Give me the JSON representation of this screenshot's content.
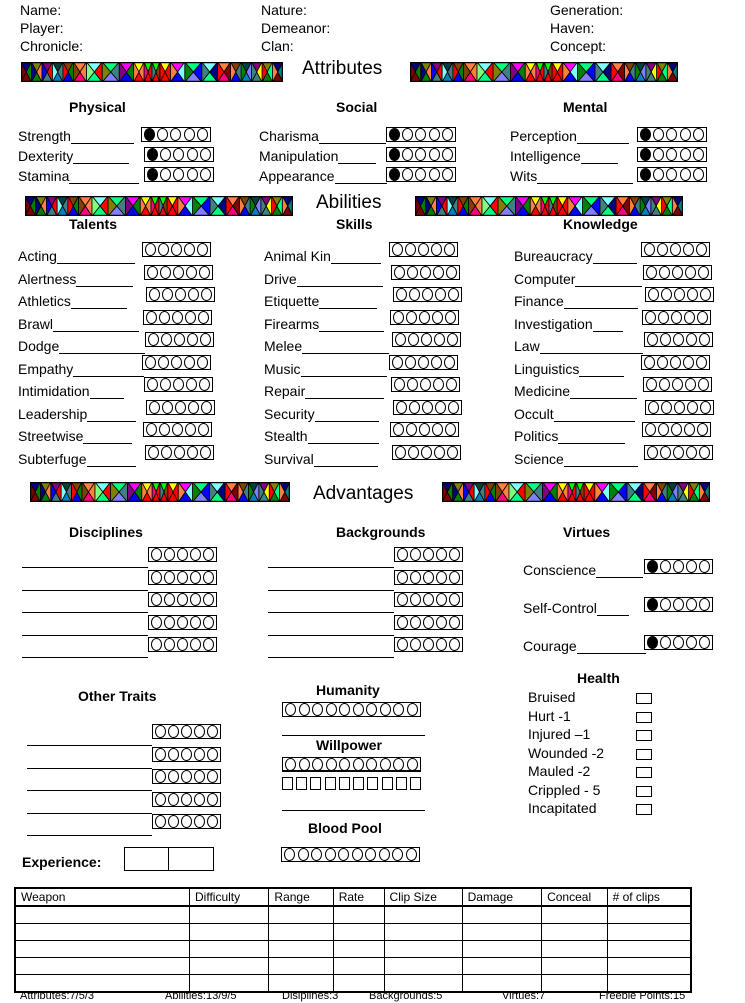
{
  "header": {
    "col1": [
      "Name:",
      "Player:",
      "Chronicle:"
    ],
    "col2": [
      "Nature:",
      "Demeanor:",
      "Clan:"
    ],
    "col3": [
      "Generation:",
      "Haven:",
      "Concept:"
    ]
  },
  "sections": {
    "attributes": "Attributes",
    "abilities": "Abilities",
    "advantages": "Advantages"
  },
  "attributes": {
    "physical": {
      "title": "Physical",
      "items": [
        {
          "label": "Strength",
          "value": 1
        },
        {
          "label": "Dexterity",
          "value": 1
        },
        {
          "label": "Stamina",
          "value": 1
        }
      ]
    },
    "social": {
      "title": "Social",
      "items": [
        {
          "label": "Charisma",
          "value": 1
        },
        {
          "label": "Manipulation",
          "value": 1
        },
        {
          "label": "Appearance",
          "value": 1
        }
      ]
    },
    "mental": {
      "title": "Mental",
      "items": [
        {
          "label": "Perception",
          "value": 1
        },
        {
          "label": "Intelligence",
          "value": 1
        },
        {
          "label": "Wits",
          "value": 1
        }
      ]
    }
  },
  "abilities": {
    "talents": {
      "title": "Talents",
      "items": [
        "Acting",
        "Alertness",
        "Athletics",
        "Brawl",
        "Dodge",
        "Empathy",
        "Intimidation",
        "Leadership",
        "Streetwise",
        "Subterfuge"
      ]
    },
    "skills": {
      "title": "Skills",
      "items": [
        "Animal Kin",
        "Drive",
        "Etiquette",
        "Firearms",
        "Melee",
        "Music",
        "Repair",
        "Security",
        "Stealth",
        "Survival"
      ]
    },
    "knowledge": {
      "title": "Knowledge",
      "items": [
        "Bureaucracy",
        "Computer",
        "Finance",
        "Investigation",
        "Law",
        "Linguistics",
        "Medicine",
        "Occult",
        "Politics",
        "Science"
      ]
    }
  },
  "advantages": {
    "disciplines": {
      "title": "Disciplines",
      "rows": 5
    },
    "backgrounds": {
      "title": "Backgrounds",
      "rows": 5
    },
    "virtues": {
      "title": "Virtues",
      "items": [
        {
          "label": "Conscience",
          "value": 1
        },
        {
          "label": "Self-Control",
          "value": 1
        },
        {
          "label": "Courage",
          "value": 1
        }
      ]
    }
  },
  "other_traits": {
    "title": "Other Traits",
    "rows": 5
  },
  "humanity": {
    "title": "Humanity",
    "dots": 10,
    "value": 0
  },
  "willpower": {
    "title": "Willpower",
    "dots": 10,
    "value": 0,
    "squares": 10
  },
  "blood_pool": {
    "title": "Blood Pool",
    "dots": 10,
    "value": 0
  },
  "experience": {
    "label": "Experience:"
  },
  "health": {
    "title": "Health",
    "levels": [
      "Bruised",
      "Hurt -1",
      "Injured –1",
      "Wounded -2",
      "Mauled -2",
      "Crippled - 5",
      "Incapitated"
    ]
  },
  "weapons": {
    "columns": [
      "Weapon",
      "Difficulty",
      "Range",
      "Rate",
      "Clip Size",
      "Damage",
      "Conceal",
      "# of clips"
    ],
    "rows": 5
  },
  "footer": [
    "Attributes:7/5/3",
    "Abilities:13/9/5",
    "Disiplines:3",
    "Backgrounds:5",
    "Virtues:7",
    "Freebie Points:15"
  ]
}
